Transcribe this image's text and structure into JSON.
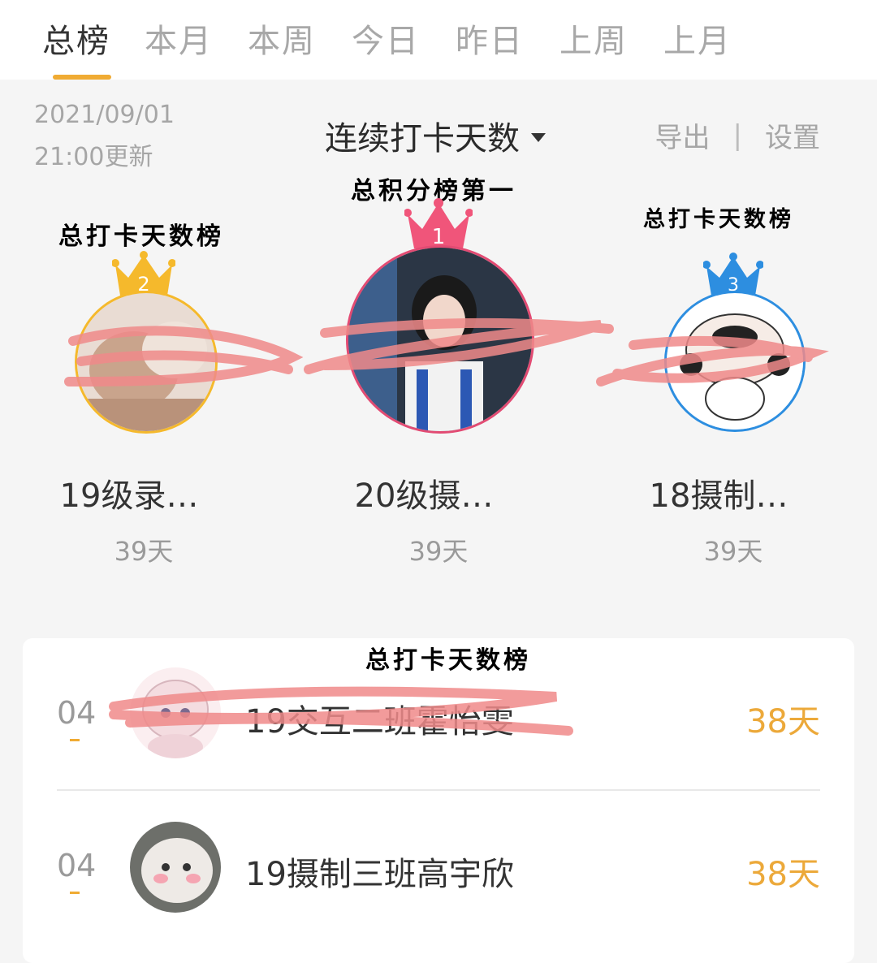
{
  "tabs": [
    "总榜",
    "本月",
    "本周",
    "今日",
    "昨日",
    "上周",
    "上月"
  ],
  "active_tab": "总榜",
  "update": {
    "date": "2021/09/01",
    "time": "21:00更新"
  },
  "sort_select": {
    "label": "连续打卡天数"
  },
  "actions": {
    "export": "导出",
    "separator": "|",
    "settings": "设置"
  },
  "annotations": {
    "first": "总积分榜第一",
    "second": "总打卡天数榜",
    "third": "总打卡天数榜",
    "list": "总打卡天数榜"
  },
  "podium": [
    {
      "rank": "1",
      "name": "20级摄…",
      "days": "39天",
      "crown_color": "#f0557a"
    },
    {
      "rank": "2",
      "name": "19级录…",
      "days": "39天",
      "crown_color": "#f5b92c"
    },
    {
      "rank": "3",
      "name": "18摄制…",
      "days": "39天",
      "crown_color": "#2d8ee0"
    }
  ],
  "list": [
    {
      "rank": "04",
      "name": "19交互二班霍怡雯",
      "days": "38天"
    },
    {
      "rank": "04",
      "name": "19摄制三班高宇欣",
      "days": "38天"
    }
  ],
  "colors": {
    "accent": "#f0ab33",
    "scribble": "#f08a8a"
  }
}
